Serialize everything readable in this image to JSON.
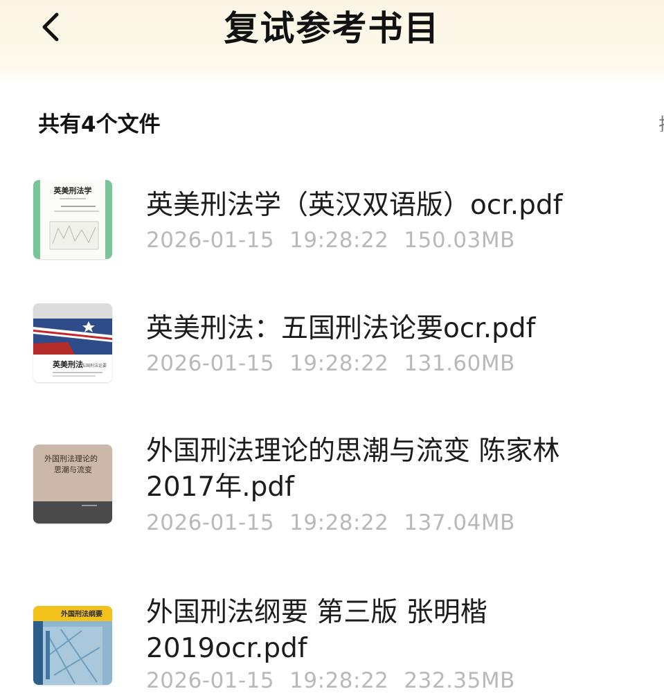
{
  "header": {
    "title": "复试参考书目",
    "back_icon": "chevron-left-icon",
    "background": "#fbf6e4"
  },
  "list": {
    "count_label": "共有4个文件",
    "files": [
      {
        "name": "英美刑法学（英汉双语版）ocr.pdf",
        "date": "2026-01-15",
        "time": "19:28:22",
        "size": "150.03MB",
        "thumb": {
          "title": "英美刑法学"
        }
      },
      {
        "name": "英美刑法：五国刑法论要ocr.pdf",
        "date": "2026-01-15",
        "time": "19:28:22",
        "size": "131.60MB",
        "thumb": {
          "title": "英美刑法",
          "subtitle": "五国刑法论要"
        }
      },
      {
        "name": "外国刑法理论的思潮与流变 陈家林 2017年.pdf",
        "date": "2026-01-15",
        "time": "19:28:22",
        "size": "137.04MB",
        "thumb": {
          "title_line1": "外国刑法理论的",
          "title_line2": "思潮与流变"
        }
      },
      {
        "name": "外国刑法纲要 第三版 张明楷 2019ocr.pdf",
        "date": "2026-01-15",
        "time": "19:28:22",
        "size": "232.35MB",
        "thumb": {
          "title": "外国刑法纲要"
        }
      }
    ]
  },
  "colors": {
    "meta_text": "#b9b9b9",
    "primary_text": "#1c1c1c"
  }
}
